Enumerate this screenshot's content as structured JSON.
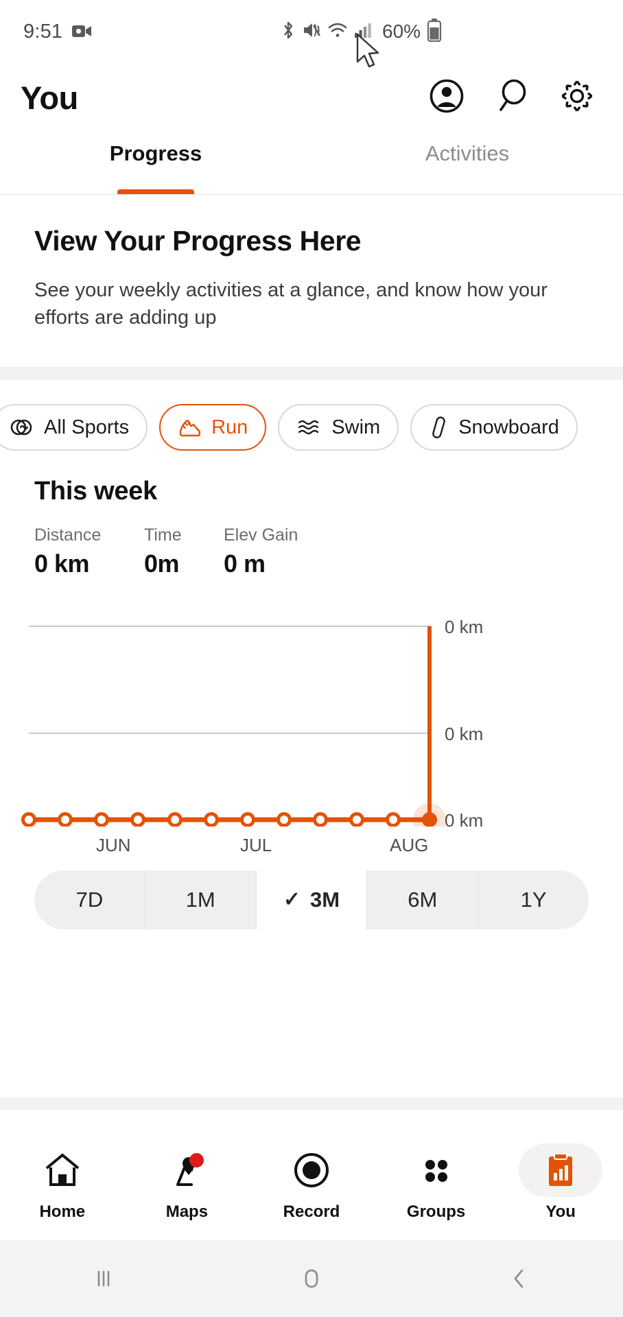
{
  "status_bar": {
    "time": "9:51",
    "battery_percent": "60%",
    "icons": [
      "camera-icon",
      "bluetooth-icon",
      "mute-icon",
      "wifi-icon",
      "signal-icon",
      "battery-icon"
    ]
  },
  "header": {
    "title": "You",
    "icons": [
      "account-circle-icon",
      "search-icon",
      "settings-gear-icon"
    ]
  },
  "tabs": [
    {
      "label": "Progress",
      "active": true
    },
    {
      "label": "Activities",
      "active": false
    }
  ],
  "intro": {
    "heading": "View Your Progress Here",
    "body": "See your weekly activities at a glance, and know how your efforts are adding up"
  },
  "sport_filters": [
    {
      "label": "All Sports",
      "icon": "all-sports-icon",
      "active": false
    },
    {
      "label": "Run",
      "icon": "shoe-icon",
      "active": true
    },
    {
      "label": "Swim",
      "icon": "waves-icon",
      "active": false
    },
    {
      "label": "Snowboard",
      "icon": "snowboard-icon",
      "active": false
    }
  ],
  "week": {
    "heading": "This week",
    "stats": [
      {
        "label": "Distance",
        "value": "0 km"
      },
      {
        "label": "Time",
        "value": "0m"
      },
      {
        "label": "Elev Gain",
        "value": "0 m"
      }
    ]
  },
  "chart_data": {
    "type": "line",
    "title": "",
    "xlabel": "",
    "ylabel": "",
    "unit": "km",
    "categories": [
      "",
      "",
      "JUN",
      "",
      "",
      "",
      "",
      "JUL",
      "",
      "",
      "",
      "AUG",
      ""
    ],
    "tick_labels": [
      "JUN",
      "JUL",
      "AUG"
    ],
    "values": [
      0,
      0,
      0,
      0,
      0,
      0,
      0,
      0,
      0,
      0,
      0,
      0,
      0
    ],
    "y_axis_labels": [
      "0 km",
      "0 km",
      "0 km"
    ],
    "ylim": [
      0,
      0
    ],
    "grid": true,
    "legend": "none",
    "line_color": "#e35205",
    "marker_style": "hollow-circle",
    "highlighted_point_index": 12,
    "highlighted_point_label": "0 km"
  },
  "range_selector": {
    "options": [
      {
        "label": "7D",
        "selected": false
      },
      {
        "label": "1M",
        "selected": false
      },
      {
        "label": "3M",
        "selected": true
      },
      {
        "label": "6M",
        "selected": false
      },
      {
        "label": "1Y",
        "selected": false
      }
    ],
    "check_glyph": "✓"
  },
  "bottom_nav": [
    {
      "label": "Home",
      "icon": "home-icon",
      "active": false,
      "badge": false
    },
    {
      "label": "Maps",
      "icon": "map-pin-icon",
      "active": false,
      "badge": true
    },
    {
      "label": "Record",
      "icon": "record-circle-icon",
      "active": false,
      "badge": false
    },
    {
      "label": "Groups",
      "icon": "groups-dots-icon",
      "active": false,
      "badge": false
    },
    {
      "label": "You",
      "icon": "clipboard-chart-icon",
      "active": true,
      "badge": false
    }
  ],
  "android_nav": {
    "recents": "recents-icon",
    "home": "home-pill-icon",
    "back": "back-chevron-icon"
  },
  "colors": {
    "accent": "#e35205",
    "badge": "#e01b1b",
    "text": "#111111",
    "muted": "#6d6d6d"
  }
}
